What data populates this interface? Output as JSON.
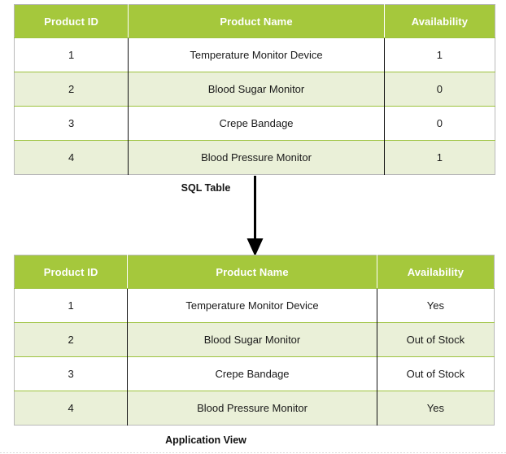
{
  "diagram": {
    "title_top": "SQL Table",
    "title_bottom": "Application View",
    "colors": {
      "header_green": "#a5c83c",
      "alt_row_green": "#eaf0d8",
      "row_border_green": "#9dc33f",
      "outer_border_gray": "#b9b9b9",
      "divider_black": "#111111",
      "header_text": "#ffffff",
      "body_text": "#1a1a1a",
      "arrow": "#000000"
    },
    "arrow": {
      "name": "downward-arrow",
      "direction": "down"
    }
  },
  "sql_table": {
    "name": "SQL Table",
    "columns": [
      "Product ID",
      "Product Name",
      "Availability"
    ],
    "rows": [
      {
        "id": "1",
        "product_name": "Temperature Monitor Device",
        "availability": "1"
      },
      {
        "id": "2",
        "product_name": "Blood Sugar Monitor",
        "availability": "0"
      },
      {
        "id": "3",
        "product_name": "Crepe Bandage",
        "availability": "0"
      },
      {
        "id": "4",
        "product_name": "Blood Pressure Monitor",
        "availability": "1"
      }
    ]
  },
  "app_table": {
    "name": "Application View",
    "columns": [
      "Product ID",
      "Product Name",
      "Availability"
    ],
    "rows": [
      {
        "id": "1",
        "product_name": "Temperature Monitor Device",
        "availability": "Yes"
      },
      {
        "id": "2",
        "product_name": "Blood Sugar Monitor",
        "availability": "Out of Stock"
      },
      {
        "id": "3",
        "product_name": "Crepe Bandage",
        "availability": "Out of Stock"
      },
      {
        "id": "4",
        "product_name": "Blood Pressure Monitor",
        "availability": "Yes"
      }
    ]
  }
}
